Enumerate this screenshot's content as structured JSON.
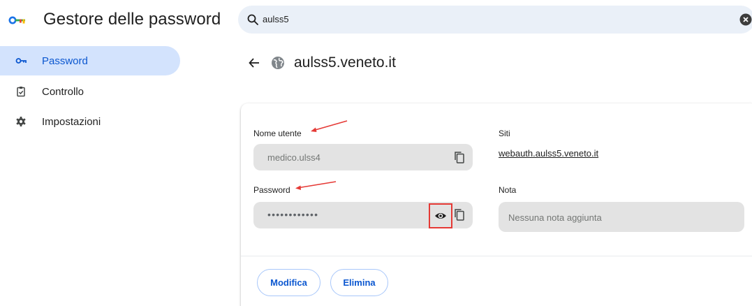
{
  "header": {
    "app_title": "Gestore delle password",
    "search_value": "aulss5",
    "logo_icon": "key-icon"
  },
  "sidebar": {
    "items": [
      {
        "label": "Password",
        "icon": "key-icon",
        "active": true
      },
      {
        "label": "Controllo",
        "icon": "clipboard-check-icon",
        "active": false
      },
      {
        "label": "Impostazioni",
        "icon": "gear-icon",
        "active": false
      }
    ]
  },
  "detail": {
    "site_title": "aulss5.veneto.it",
    "username_label": "Nome utente",
    "username_value": "medico.ulss4",
    "password_label": "Password",
    "password_masked": "••••••••••••",
    "sites_label": "Siti",
    "site_link": "webauth.aulss5.veneto.it",
    "note_label": "Nota",
    "note_placeholder": "Nessuna nota aggiunta",
    "edit_button": "Modifica",
    "delete_button": "Elimina"
  },
  "colors": {
    "accent": "#0b57d0",
    "active_nav_bg": "#d3e3fd",
    "search_bg": "#eaf0f8",
    "field_bg": "#e3e3e3",
    "annotation_red": "#e53935"
  }
}
